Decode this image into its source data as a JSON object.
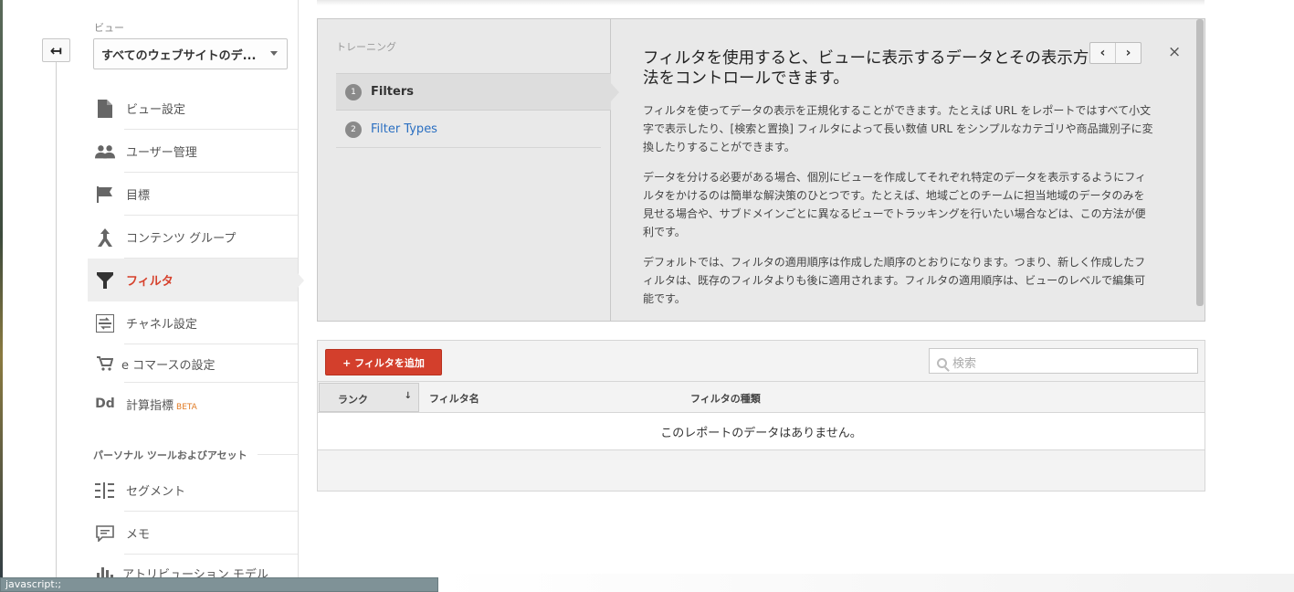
{
  "view": {
    "label": "ビュー",
    "selected": "すべてのウェブサイトのデ..."
  },
  "icons": {
    "back": "back-arrow-icon",
    "dropdown": "chevron-down-icon",
    "search": "search-icon",
    "close": "close-icon"
  },
  "sidebar": {
    "items": [
      {
        "label": "ビュー設定",
        "icon": "document-icon"
      },
      {
        "label": "ユーザー管理",
        "icon": "users-icon"
      },
      {
        "label": "目標",
        "icon": "flag-icon"
      },
      {
        "label": "コンテンツ グループ",
        "icon": "content-group-icon"
      },
      {
        "label": "フィルタ",
        "icon": "filter-icon",
        "active": true
      },
      {
        "label": "チャネル設定",
        "icon": "channel-icon"
      },
      {
        "label": "e コマースの設定",
        "icon": "cart-icon"
      },
      {
        "label": "計算指標",
        "badge": "BETA",
        "icon": "calculated-metric-icon"
      }
    ],
    "section_heading": "パーソナル ツールおよびアセット",
    "personal_items": [
      {
        "label": "セグメント",
        "icon": "segment-icon"
      },
      {
        "label": "メモ",
        "icon": "note-icon"
      },
      {
        "label": "アトリビューション モデル",
        "icon": "attribution-icon"
      }
    ]
  },
  "training": {
    "title": "トレーニング",
    "steps": [
      {
        "num": "1",
        "label": "Filters"
      },
      {
        "num": "2",
        "label": "Filter Types"
      }
    ],
    "heading": "フィルタを使用すると、ビューに表示するデータとその表示方法をコントロールできます。",
    "paragraphs": [
      "フィルタを使ってデータの表示を正規化することができます。たとえば URL をレポートではすべて小文字で表示したり、[検索と置換] フィルタによって長い数値 URL をシンプルなカテゴリや商品識別子に変換したりすることができます。",
      "データを分ける必要がある場合、個別にビューを作成してそれぞれ特定のデータを表示するようにフィルタをかけるのは簡単な解決策のひとつです。たとえば、地域ごとのチームに担当地域のデータのみを見せる場合や、サブドメインごとに異なるビューでトラッキングを行いたい場合などは、この方法が便利です。",
      "デフォルトでは、フィルタの適用順序は作成した順序のとおりになります。つまり、新しく作成したフィルタは、既存のフィルタよりも後に適用されます。フィルタの適用順序は、ビューのレベルで編集可能です。"
    ],
    "prev_label": "‹",
    "next_label": "›",
    "close_label": "×"
  },
  "filters": {
    "add_button": "+ フィルタを追加",
    "search_placeholder": "検索",
    "columns": [
      "ランク",
      "フィルタ名",
      "フィルタの種類"
    ],
    "sort_indicator": "↓",
    "empty_message": "このレポートのデータはありません。"
  },
  "status_bar": "javascript:;",
  "colors": {
    "accent": "#d6402b",
    "add_button": "#d33f2c",
    "link": "#2a6fc1",
    "beta": "#e07a23"
  }
}
